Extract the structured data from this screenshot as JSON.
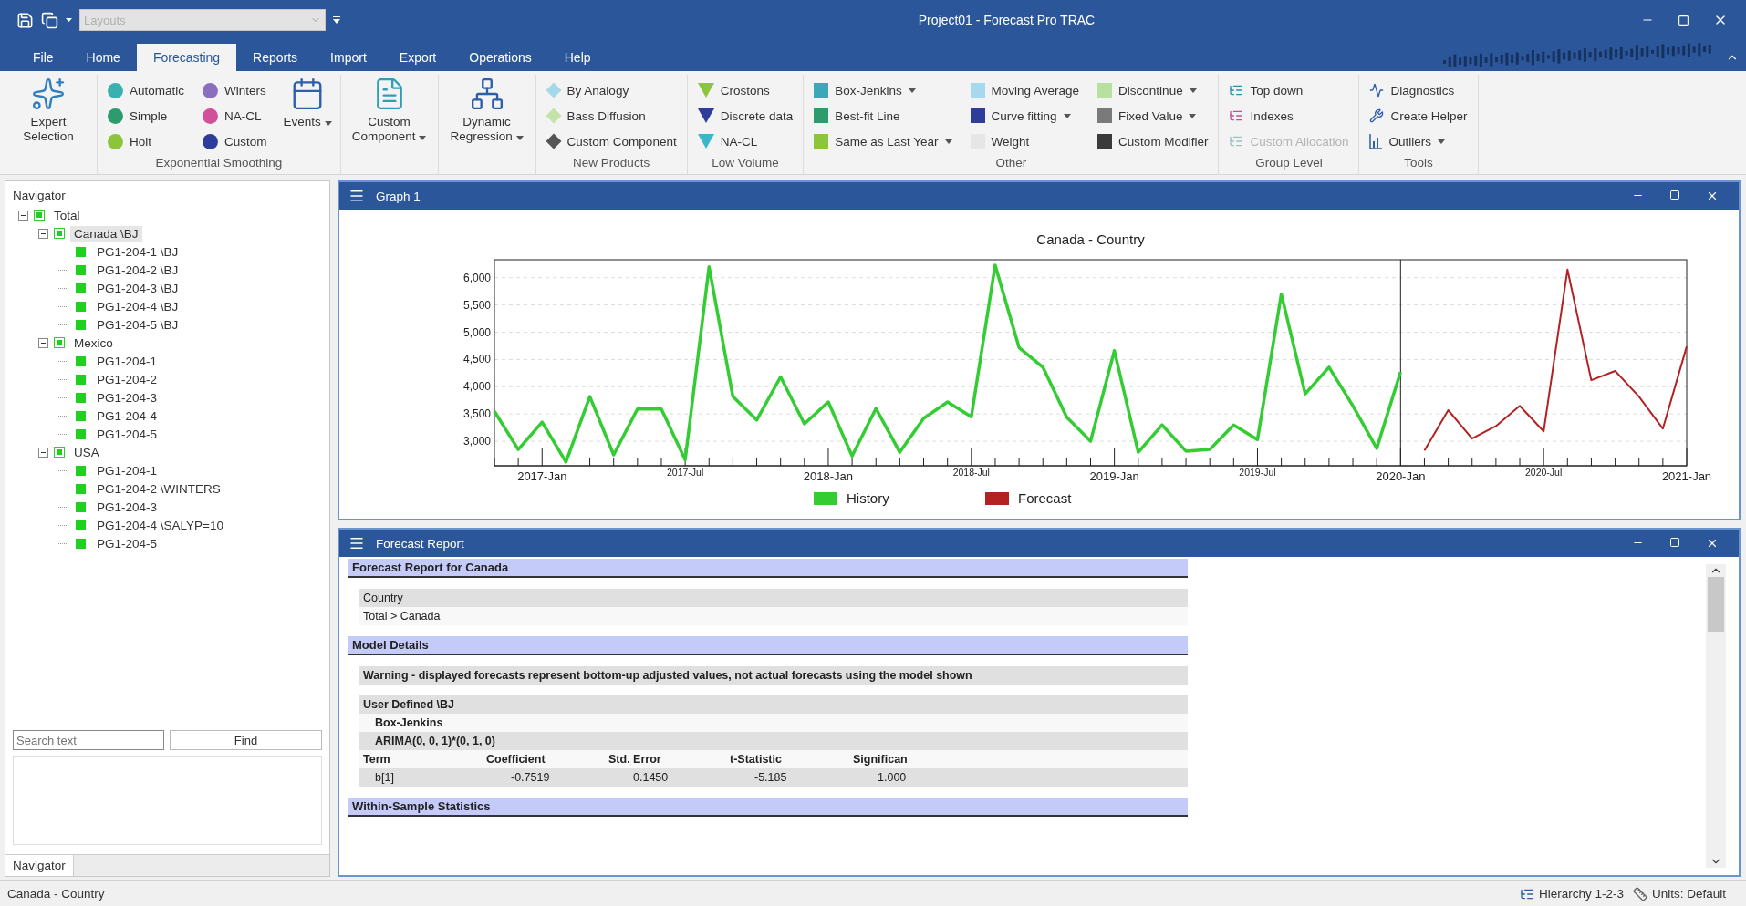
{
  "window": {
    "title": "Project01 - Forecast Pro TRAC",
    "layouts": {
      "value": "Layouts",
      "disabled": true
    }
  },
  "menu_tabs": [
    {
      "label": "File",
      "selected": false
    },
    {
      "label": "Home",
      "selected": false
    },
    {
      "label": "Forecasting",
      "selected": true
    },
    {
      "label": "Reports",
      "selected": false
    },
    {
      "label": "Import",
      "selected": false
    },
    {
      "label": "Export",
      "selected": false
    },
    {
      "label": "Operations",
      "selected": false
    },
    {
      "label": "Help",
      "selected": false
    }
  ],
  "ribbon": {
    "groups": [
      {
        "columns": [
          {
            "kind": "large",
            "label": "Expert Selection",
            "dropdown": false
          }
        ]
      },
      {
        "label": "Exponential Smoothing",
        "columns": [
          {
            "kind": "circles",
            "items": [
              {
                "label": "Automatic",
                "color": "#3ab0b0",
                "dropdown": false
              },
              {
                "label": "Simple",
                "color": "#2e9a6e",
                "dropdown": false
              },
              {
                "label": "Holt",
                "color": "#8cc43c",
                "dropdown": false
              }
            ]
          },
          {
            "kind": "circles",
            "items": [
              {
                "label": "Winters",
                "color": "#8a6fbf",
                "dropdown": false
              },
              {
                "label": "NA-CL",
                "color": "#d24f9a",
                "dropdown": false
              },
              {
                "label": "Custom",
                "color": "#2e3d99",
                "dropdown": false
              }
            ]
          },
          {
            "kind": "large",
            "label": "Events",
            "dropdown": true
          }
        ]
      },
      {
        "columns": [
          {
            "kind": "large",
            "label": "Custom Component",
            "dropdown": true
          }
        ]
      },
      {
        "columns": [
          {
            "kind": "large",
            "label": "Dynamic Regression",
            "dropdown": true
          }
        ]
      },
      {
        "label": "New Products",
        "columns": [
          {
            "kind": "diamonds",
            "items": [
              {
                "label": "By Analogy",
                "color": "#a6d9e8",
                "dropdown": false
              },
              {
                "label": "Bass Diffusion",
                "color": "#c4e3a8",
                "dropdown": false
              },
              {
                "label": "Custom Component",
                "color": "#555555",
                "dropdown": false
              }
            ]
          }
        ]
      },
      {
        "label": "Low Volume",
        "columns": [
          {
            "kind": "triangles",
            "items": [
              {
                "label": "Crostons",
                "color": "#8cc43c",
                "dropdown": false
              },
              {
                "label": "Discrete data",
                "color": "#2e3d99",
                "dropdown": false
              },
              {
                "label": "NA-CL",
                "color": "#3ab8c8",
                "dropdown": false
              }
            ]
          }
        ]
      },
      {
        "label": "Other",
        "columns": [
          {
            "kind": "squares",
            "items": [
              {
                "label": "Box-Jenkins",
                "color": "#3aa8b8",
                "dropdown": true
              },
              {
                "label": "Best-fit Line",
                "color": "#2e9a6e",
                "dropdown": false
              },
              {
                "label": "Same as Last Year",
                "color": "#8cc43c",
                "dropdown": true
              }
            ]
          },
          {
            "kind": "squares",
            "items": [
              {
                "label": "Moving Average",
                "color": "#a6d9ee",
                "dropdown": false
              },
              {
                "label": "Curve fitting",
                "color": "#2e3d99",
                "dropdown": true
              },
              {
                "label": "Weight",
                "color": "#e6e6e6",
                "dropdown": false
              }
            ]
          },
          {
            "kind": "squares",
            "items": [
              {
                "label": "Discontinue",
                "color": "#b8e0a0",
                "dropdown": true
              },
              {
                "label": "Fixed Value",
                "color": "#7a7a7a",
                "dropdown": true
              },
              {
                "label": "Custom Modifier",
                "color": "#3a3a3a",
                "dropdown": false
              }
            ]
          }
        ]
      },
      {
        "label": "Group Level",
        "columns": [
          {
            "kind": "hierarchy",
            "items": [
              {
                "label": "Top down",
                "color": "#2f8fa8",
                "dropdown": false,
                "disabled": false
              },
              {
                "label": "Indexes",
                "color": "#c0509a",
                "dropdown": false,
                "disabled": false
              },
              {
                "label": "Custom Allocation",
                "color": "#9fc0c0",
                "dropdown": false,
                "disabled": true
              }
            ]
          }
        ]
      },
      {
        "label": "Tools",
        "columns": [
          {
            "kind": "tools",
            "items": [
              {
                "label": "Diagnostics",
                "color": "#2e5fa8",
                "dropdown": false
              },
              {
                "label": "Create Helper",
                "color": "#2e5fa8",
                "dropdown": false
              },
              {
                "label": "Outliers",
                "color": "#2e5fa8",
                "dropdown": true
              }
            ]
          }
        ]
      }
    ]
  },
  "navigator": {
    "title": "Navigator",
    "tree": [
      {
        "label": "Total",
        "expanded": true,
        "selected": false,
        "children": [
          {
            "label": "Canada \\BJ",
            "expanded": true,
            "selected": true,
            "children": [
              {
                "label": "PG1-204-1 \\BJ",
                "selected": false
              },
              {
                "label": "PG1-204-2 \\BJ",
                "selected": false
              },
              {
                "label": "PG1-204-3 \\BJ",
                "selected": false
              },
              {
                "label": "PG1-204-4 \\BJ",
                "selected": false
              },
              {
                "label": "PG1-204-5 \\BJ",
                "selected": false
              }
            ]
          },
          {
            "label": "Mexico",
            "expanded": true,
            "selected": false,
            "children": [
              {
                "label": "PG1-204-1",
                "selected": false
              },
              {
                "label": "PG1-204-2",
                "selected": false
              },
              {
                "label": "PG1-204-3",
                "selected": false
              },
              {
                "label": "PG1-204-4",
                "selected": false
              },
              {
                "label": "PG1-204-5",
                "selected": false
              }
            ]
          },
          {
            "label": "USA",
            "expanded": true,
            "selected": false,
            "children": [
              {
                "label": "PG1-204-1",
                "selected": false
              },
              {
                "label": "PG1-204-2 \\WINTERS",
                "selected": false
              },
              {
                "label": "PG1-204-3",
                "selected": false
              },
              {
                "label": "PG1-204-4 \\SALYP=10",
                "selected": false
              },
              {
                "label": "PG1-204-5",
                "selected": false
              }
            ]
          }
        ]
      }
    ],
    "search": {
      "placeholder": "Search text"
    },
    "find_button": "Find",
    "tabs": [
      {
        "label": "Navigator",
        "selected": true
      }
    ]
  },
  "graph_window": {
    "title": "Graph 1",
    "chart_data": {
      "type": "line",
      "title": "Canada - Country",
      "categories": [
        null,
        null,
        "2017-Jan",
        null,
        null,
        null,
        null,
        null,
        "2017-Jul",
        null,
        null,
        null,
        null,
        null,
        "2018-Jan",
        null,
        null,
        null,
        null,
        null,
        "2018-Jul",
        null,
        null,
        null,
        null,
        null,
        "2019-Jan",
        null,
        null,
        null,
        null,
        null,
        "2019-Jul",
        null,
        null,
        null,
        null,
        null,
        "2020-Jan",
        null,
        null,
        null,
        null,
        null,
        "2020-Jul",
        null,
        null,
        null,
        null,
        null,
        "2021-Jan"
      ],
      "ylim": [
        2550,
        6330
      ],
      "grid": true,
      "legend": "bottom",
      "yticks": [
        {
          "value": 3000,
          "label": "3,000"
        },
        {
          "value": 3500,
          "label": "3,500"
        },
        {
          "value": 4000,
          "label": "4,000"
        },
        {
          "value": 4500,
          "label": "4,500"
        },
        {
          "value": 5000,
          "label": "5,000"
        },
        {
          "value": 5500,
          "label": "5,500"
        },
        {
          "value": 6000,
          "label": "6,000"
        }
      ],
      "series": [
        {
          "name": "History",
          "color": "#33cc33",
          "values": [
            3550,
            2850,
            3350,
            2620,
            3820,
            2750,
            3590,
            3590,
            2660,
            6200,
            3820,
            3390,
            4180,
            3320,
            3720,
            2730,
            3600,
            2800,
            3420,
            3720,
            3450,
            6230,
            4720,
            4360,
            3440,
            3000,
            4660,
            2800,
            3300,
            2820,
            2850,
            3300,
            3030,
            5700,
            3870,
            4360,
            3650,
            2870,
            4270,
            null,
            null,
            null,
            null,
            null,
            null,
            null,
            null,
            null,
            null,
            null,
            null
          ]
        },
        {
          "name": "Forecast",
          "color": "#b22222",
          "values": [
            null,
            null,
            null,
            null,
            null,
            null,
            null,
            null,
            null,
            null,
            null,
            null,
            null,
            null,
            null,
            null,
            null,
            null,
            null,
            null,
            null,
            null,
            null,
            null,
            null,
            null,
            null,
            null,
            null,
            null,
            null,
            null,
            null,
            null,
            null,
            null,
            null,
            null,
            null,
            2830,
            3570,
            3050,
            3280,
            3650,
            3180,
            6150,
            4120,
            4290,
            3820,
            3230,
            4740
          ]
        }
      ]
    }
  },
  "report_window": {
    "title": "Forecast Report",
    "sections": [
      {
        "title": "Forecast Report for Canada",
        "blocks": [
          [
            {
              "kind": "text",
              "cells": [
                "Country"
              ],
              "shaded": true,
              "bold": false,
              "indent": false
            },
            {
              "kind": "text",
              "cells": [
                "Total > Canada"
              ],
              "shaded": false,
              "bold": false,
              "indent": false
            }
          ]
        ]
      },
      {
        "title": "Model Details",
        "blocks": [
          [
            {
              "kind": "text",
              "cells": [
                "Warning - displayed forecasts represent bottom-up adjusted values, not actual forecasts using the model shown"
              ],
              "shaded": true,
              "bold": true,
              "indent": false
            }
          ],
          [
            {
              "kind": "text",
              "cells": [
                "User Defined \\BJ"
              ],
              "shaded": true,
              "bold": true,
              "indent": false
            },
            {
              "kind": "text",
              "cells": [
                "Box-Jenkins"
              ],
              "shaded": false,
              "bold": true,
              "indent": true
            },
            {
              "kind": "text",
              "cells": [
                "ARIMA(0, 0, 1)*(0, 1, 0)"
              ],
              "shaded": true,
              "bold": true,
              "indent": true
            },
            {
              "kind": "columns",
              "cells": [
                "Term",
                "Coefficient",
                "Std. Error",
                "t-Statistic",
                "Significan"
              ],
              "shaded": false,
              "bold": true,
              "indent": false
            },
            {
              "kind": "columns",
              "cells": [
                "b[1]",
                "-0.7519",
                "0.1450",
                "-5.185",
                "1.000"
              ],
              "shaded": true,
              "bold": false,
              "indent": true
            }
          ]
        ]
      },
      {
        "title": "Within-Sample Statistics"
      }
    ]
  },
  "status_bar": {
    "text": "Canada - Country",
    "items": [
      "Hierarchy 1-2-3",
      "Units: Default"
    ]
  }
}
